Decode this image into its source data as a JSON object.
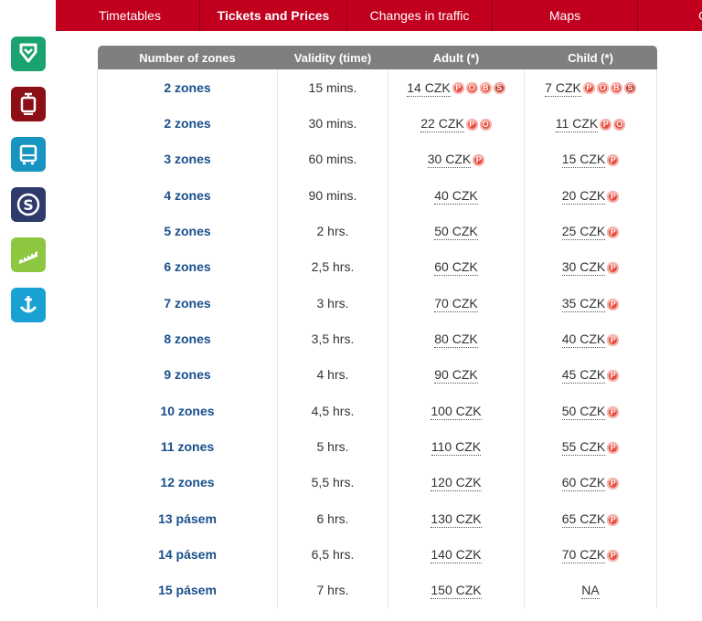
{
  "nav": {
    "tabs": [
      "Timetables",
      "Tickets and Prices",
      "Changes in traffic",
      "Maps",
      "Co"
    ]
  },
  "sidebar": {
    "icons": [
      "metro-icon",
      "tram-icon",
      "bus-icon",
      "train-icon",
      "funicular-icon",
      "ferry-icon"
    ]
  },
  "colors": {
    "accent": "#c1001e",
    "metro": "#1aa36e",
    "tram": "#8b0f14",
    "bus": "#1795c0",
    "train": "#2d3a6b",
    "funicular": "#8dc63f",
    "ferry": "#19a1d4",
    "zone_text": "#1a4f8c"
  },
  "table": {
    "headers": [
      "Number of zones",
      "Validity (time)",
      "Adult (*)",
      "Child (*)"
    ],
    "rows": [
      {
        "zones": "2 zones",
        "validity": "15 mins.",
        "adult": "14 CZK",
        "adult_badges": 4,
        "child": "7 CZK",
        "child_badges": 4
      },
      {
        "zones": "2 zones",
        "validity": "30 mins.",
        "adult": "22 CZK",
        "adult_badges": 2,
        "child": "11 CZK",
        "child_badges": 2
      },
      {
        "zones": "3 zones",
        "validity": "60 mins.",
        "adult": "30 CZK",
        "adult_badges": 1,
        "child": "15 CZK",
        "child_badges": 1
      },
      {
        "zones": "4 zones",
        "validity": "90 mins.",
        "adult": "40 CZK",
        "adult_badges": 0,
        "child": "20 CZK",
        "child_badges": 1
      },
      {
        "zones": "5 zones",
        "validity": "2 hrs.",
        "adult": "50 CZK",
        "adult_badges": 0,
        "child": "25 CZK",
        "child_badges": 1
      },
      {
        "zones": "6 zones",
        "validity": "2,5 hrs.",
        "adult": "60 CZK",
        "adult_badges": 0,
        "child": "30 CZK",
        "child_badges": 1
      },
      {
        "zones": "7 zones",
        "validity": "3 hrs.",
        "adult": "70 CZK",
        "adult_badges": 0,
        "child": "35 CZK",
        "child_badges": 1
      },
      {
        "zones": "8 zones",
        "validity": "3,5 hrs.",
        "adult": "80 CZK",
        "adult_badges": 0,
        "child": "40 CZK",
        "child_badges": 1
      },
      {
        "zones": "9 zones",
        "validity": "4 hrs.",
        "adult": "90 CZK",
        "adult_badges": 0,
        "child": "45 CZK",
        "child_badges": 1
      },
      {
        "zones": "10 zones",
        "validity": "4,5 hrs.",
        "adult": "100 CZK",
        "adult_badges": 0,
        "child": "50 CZK",
        "child_badges": 1
      },
      {
        "zones": "11 zones",
        "validity": "5 hrs.",
        "adult": "110 CZK",
        "adult_badges": 0,
        "child": "55 CZK",
        "child_badges": 1
      },
      {
        "zones": "12 zones",
        "validity": "5,5 hrs.",
        "adult": "120 CZK",
        "adult_badges": 0,
        "child": "60 CZK",
        "child_badges": 1
      },
      {
        "zones": "13 pásem",
        "validity": "6 hrs.",
        "adult": "130 CZK",
        "adult_badges": 0,
        "child": "65 CZK",
        "child_badges": 1
      },
      {
        "zones": "14 pásem",
        "validity": "6,5 hrs.",
        "adult": "140 CZK",
        "adult_badges": 0,
        "child": "70 CZK",
        "child_badges": 1
      },
      {
        "zones": "15 pásem",
        "validity": "7 hrs.",
        "adult": "150 CZK",
        "adult_badges": 0,
        "child": "NA",
        "child_badges": 0
      }
    ]
  }
}
